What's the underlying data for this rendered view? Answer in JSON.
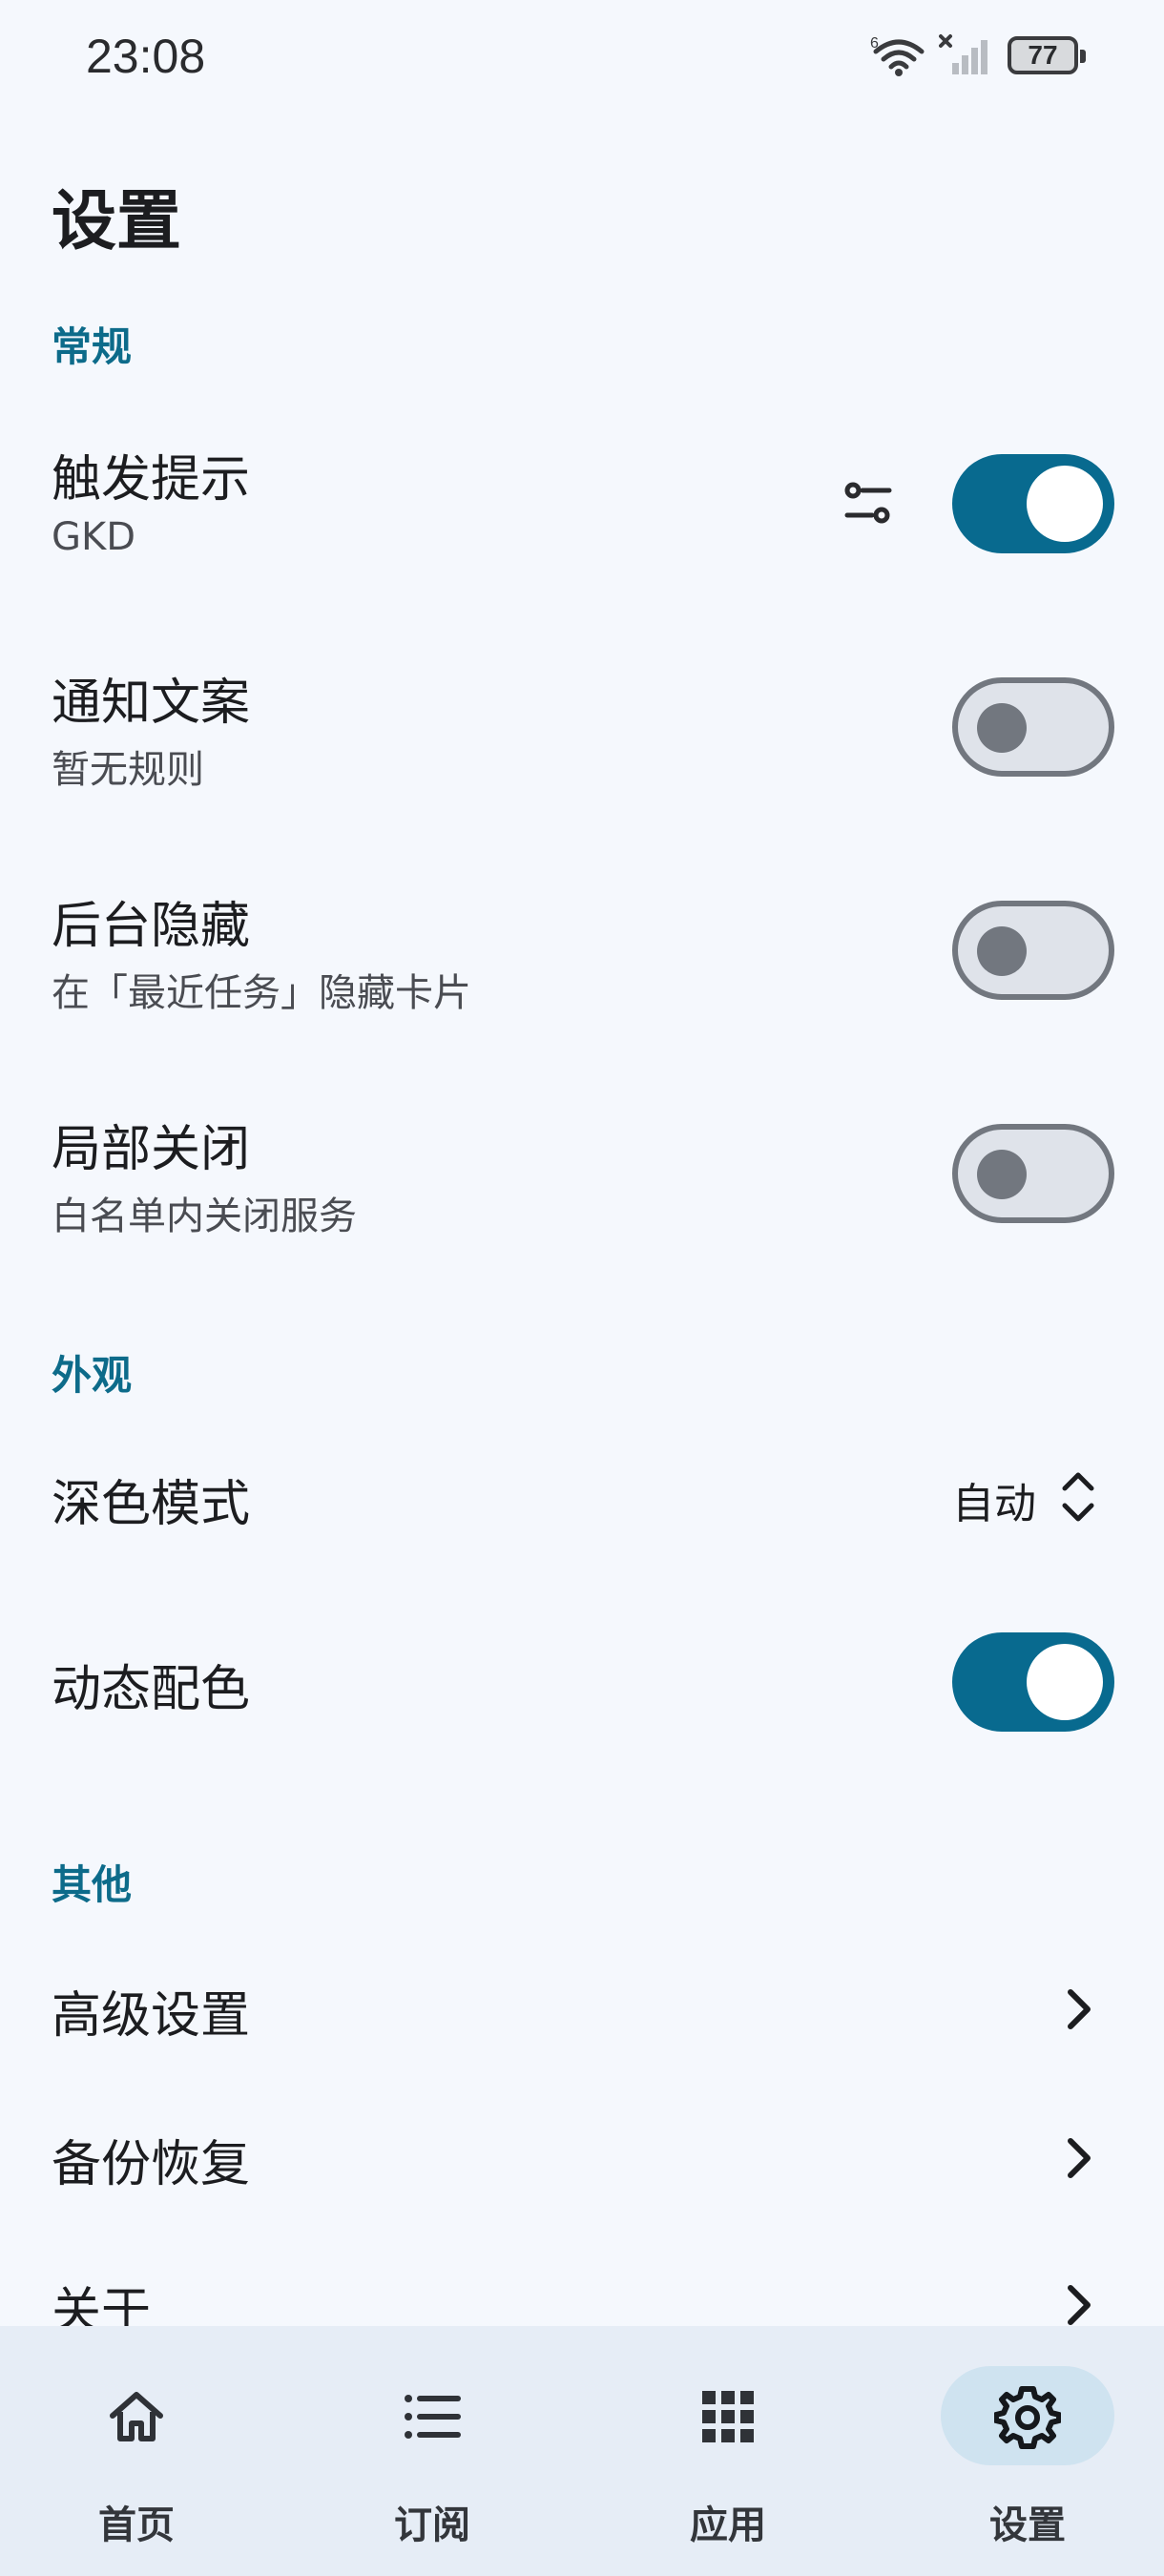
{
  "status_bar": {
    "time": "23:08",
    "battery": "77",
    "network_label": "6"
  },
  "page": {
    "title": "设置"
  },
  "sections": {
    "general": "常规",
    "appearance": "外观",
    "other": "其他"
  },
  "settings": {
    "trigger_tip": {
      "title": "触发提示",
      "subtitle": "GKD",
      "enabled": true
    },
    "notification_text": {
      "title": "通知文案",
      "subtitle": "暂无规则",
      "enabled": false
    },
    "background_hide": {
      "title": "后台隐藏",
      "subtitle": "在「最近任务」隐藏卡片",
      "enabled": false
    },
    "partial_close": {
      "title": "局部关闭",
      "subtitle": "白名单内关闭服务",
      "enabled": false
    },
    "dark_mode": {
      "title": "深色模式",
      "value": "自动"
    },
    "dynamic_color": {
      "title": "动态配色",
      "enabled": true
    },
    "advanced": {
      "title": "高级设置"
    },
    "backup": {
      "title": "备份恢复"
    },
    "about": {
      "title": "关于"
    }
  },
  "bottom_nav": {
    "items": [
      {
        "label": "首页",
        "icon": "home-icon",
        "active": false
      },
      {
        "label": "订阅",
        "icon": "list-icon",
        "active": false
      },
      {
        "label": "应用",
        "icon": "grid-icon",
        "active": false
      },
      {
        "label": "设置",
        "icon": "gear-icon",
        "active": true
      }
    ]
  },
  "colors": {
    "accent": "#086a8f",
    "section_header": "#0d6b8a",
    "background": "#f5f8fd",
    "nav_background": "#e6edf6",
    "switch_off_track": "#dfe3ea",
    "switch_off_outline": "#72777f"
  }
}
